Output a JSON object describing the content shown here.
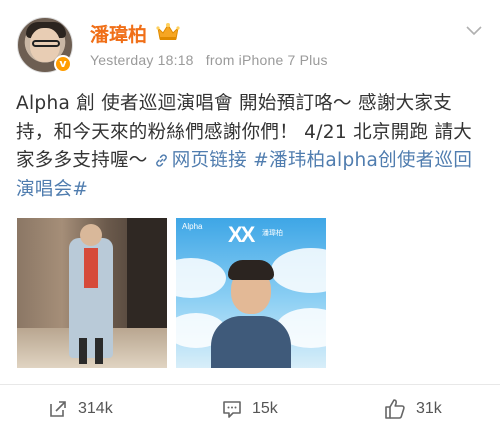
{
  "post": {
    "user": {
      "name": "潘瑋柏",
      "verified_icon": "v-badge-icon",
      "crown_icon": "crown-icon"
    },
    "meta": {
      "time": "Yesterday 18:18",
      "source": "from iPhone 7 Plus"
    },
    "text": {
      "main": "Alpha 創 使者巡迴演唱會 開始預訂咯～ 感謝大家支持，和今天來的粉絲們感謝你們！ 4/21 北京開跑 請大家多多支持喔～ ",
      "link_icon": "link-icon",
      "link_label": "网页链接",
      "hashtag": " #潘玮柏alpha创使者巡回演唱会#"
    },
    "images": [
      {
        "name": "photo-man-in-blue-coat"
      },
      {
        "name": "poster-alpha-tour",
        "poster_text_alpha": "Alpha",
        "poster_text_xx": "XX",
        "poster_text_sig": "潘瑋柏"
      }
    ],
    "actions": {
      "repost": {
        "icon": "repost-icon",
        "count": "314k"
      },
      "comment": {
        "icon": "comment-icon",
        "count": "15k"
      },
      "like": {
        "icon": "thumbs-up-icon",
        "count": "31k"
      }
    },
    "colors": {
      "username": "#f06f18",
      "link": "#507daf",
      "meta": "#9a9a9a",
      "badge": "#ff9d00"
    }
  }
}
